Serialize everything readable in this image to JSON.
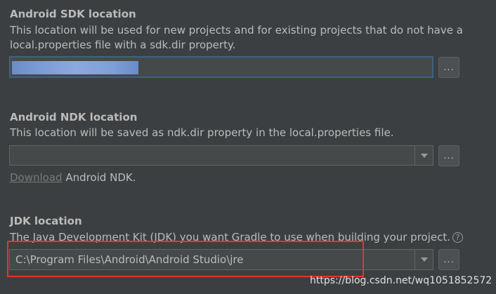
{
  "sdk": {
    "heading": "Android SDK location",
    "description_line1": "This location will be used for new projects and for existing projects that do not have a",
    "description_line2": "local.properties file with a sdk.dir property.",
    "browse_label": "..."
  },
  "ndk": {
    "heading": "Android NDK location",
    "description": "This location will be saved as ndk.dir property in the local.properties file.",
    "download_link": "Download",
    "download_suffix": " Android NDK.",
    "browse_label": "..."
  },
  "jdk": {
    "heading": "JDK location",
    "description": "The Java Development Kit (JDK) you want Gradle to use when building your project.",
    "help_glyph": "?",
    "path_value": "C:\\Program Files\\Android\\Android Studio\\jre",
    "browse_label": "..."
  },
  "watermark": "https://blog.csdn.net/wq1051852572",
  "colors": {
    "background": "#3c3f41",
    "text": "#bbbbbb",
    "focus_border": "#3d6185",
    "highlight_box": "#e8322f"
  }
}
